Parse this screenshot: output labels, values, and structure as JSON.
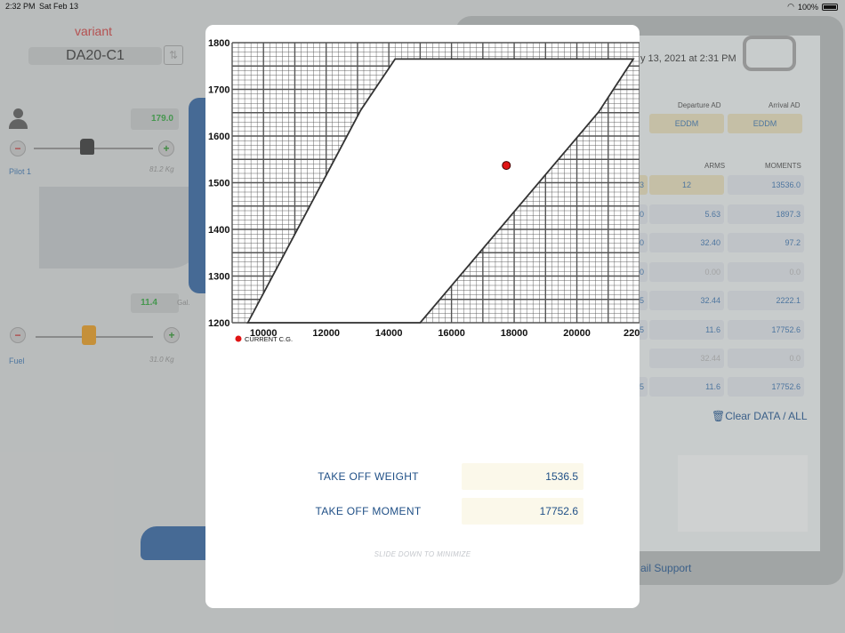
{
  "status_bar": {
    "time": "2:32 PM",
    "date": "Sat Feb 13",
    "battery": "100%"
  },
  "left_panel": {
    "variant_label": "variant",
    "model": "DA20-C1",
    "pilot": {
      "label": "Pilot 1",
      "value": "179.0",
      "kg": "81.2  Kg"
    },
    "fuel": {
      "label": "Fuel",
      "value": "11.4",
      "unit": "Gal.",
      "kg": "31.0  Kg"
    }
  },
  "sheet": {
    "date_text": "y 13, 2021 at 2:31 PM",
    "departure_header": "Departure AD",
    "arrival_header": "Arrival AD",
    "departure_value": "EDDM",
    "arrival_value": "EDDM",
    "arms_header": "ARMS",
    "moments_header": "MOMENTS",
    "rows": [
      {
        "left": "3",
        "arm": "12",
        "moment": "13536.0",
        "tan": true
      },
      {
        "left": ".0",
        "arm": "5.63",
        "moment": "1897.3"
      },
      {
        "left": ".0",
        "arm": "32.40",
        "moment": "97.2"
      },
      {
        "left": ".0",
        "arm": "0.00",
        "moment": "0.0",
        "grey": true
      },
      {
        "left": ".5",
        "arm": "32.44",
        "moment": "2222.1"
      },
      {
        "left": ".5",
        "arm": "11.6",
        "moment": "17752.6"
      },
      {
        "left": "",
        "arm": "32.44",
        "moment": "0.0",
        "grey": true
      },
      {
        "left": ".5",
        "arm": "11.6",
        "moment": "17752.6"
      }
    ],
    "clear_label": "Clear DATA / ALL",
    "support_label": "ail Support"
  },
  "chart_data": {
    "type": "scatter",
    "x_ticks": [
      "10000",
      "12000",
      "14000",
      "16000",
      "18000",
      "20000",
      "2200"
    ],
    "y_ticks": [
      "1800",
      "1700",
      "1600",
      "1500",
      "1400",
      "1300",
      "1200"
    ],
    "xlim": [
      9000,
      22000
    ],
    "ylim": [
      1200,
      1800
    ],
    "envelope": [
      {
        "x": 9500,
        "y": 1200
      },
      {
        "x": 13100,
        "y": 1655
      },
      {
        "x": 14200,
        "y": 1765
      },
      {
        "x": 21800,
        "y": 1765
      },
      {
        "x": 20700,
        "y": 1652
      },
      {
        "x": 15000,
        "y": 1200
      }
    ],
    "current_point": {
      "x": 17750,
      "y": 1537
    },
    "legend_label": "CURRENT C.G.",
    "point_color": "#e01414"
  },
  "readouts": {
    "weight_label": "TAKE OFF WEIGHT",
    "weight_value": "1536.5",
    "moment_label": "TAKE OFF MOMENT",
    "moment_value": "17752.6"
  },
  "hint": "SLIDE DOWN TO MINIMIZE"
}
